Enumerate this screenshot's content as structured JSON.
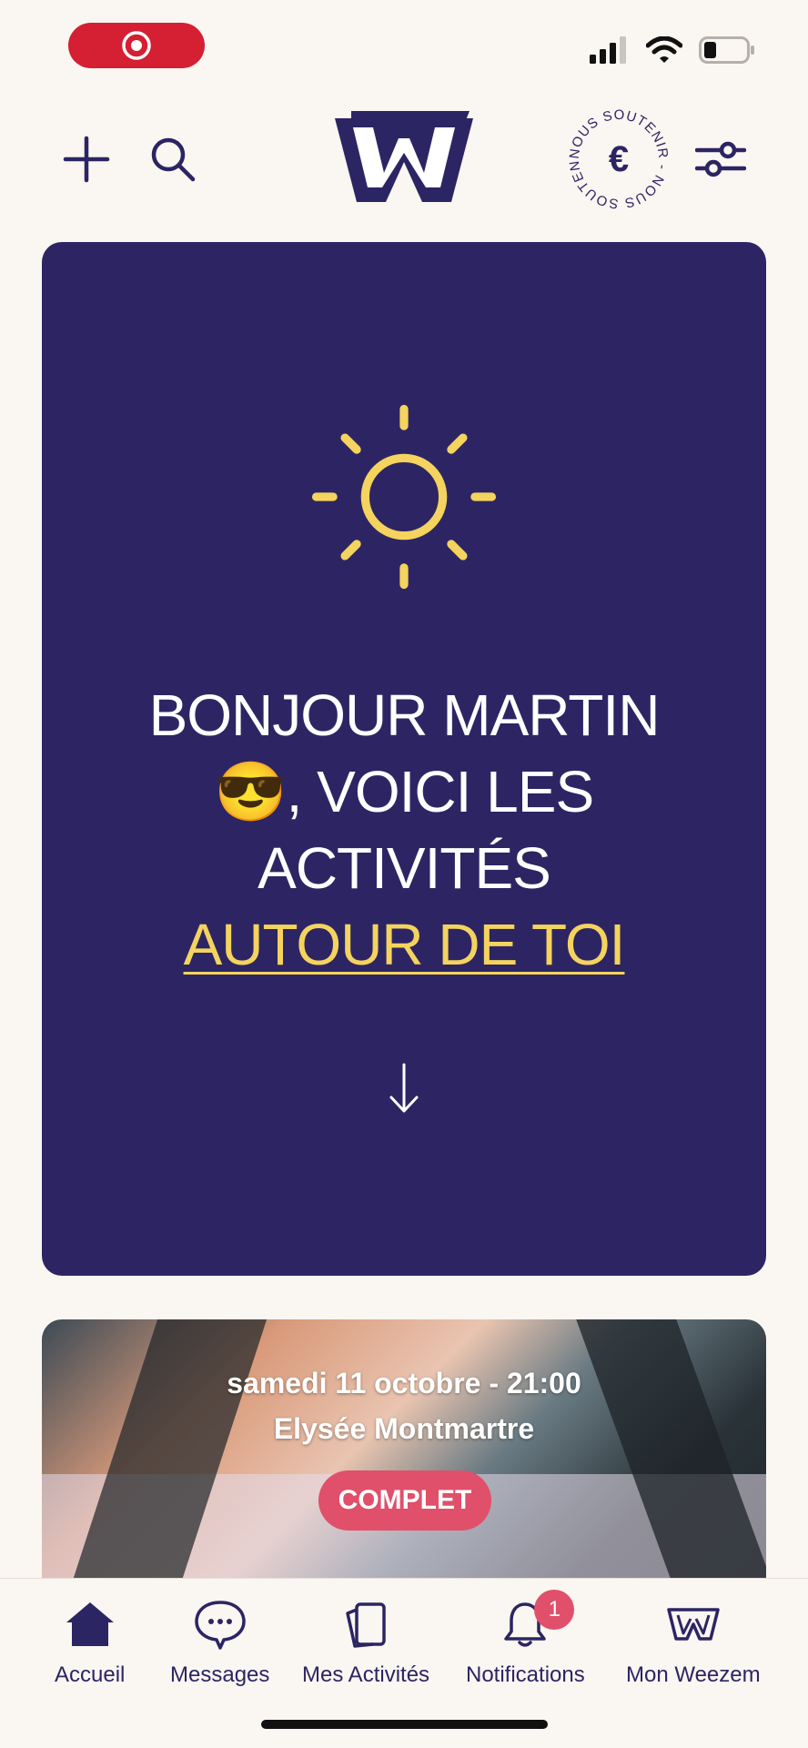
{
  "colors": {
    "primary": "#2d2563",
    "accent_yellow": "#f4d35e",
    "badge_pink": "#e0506a",
    "record_red": "#d51f33",
    "background": "#faf6f1"
  },
  "status_bar": {
    "icons": [
      "record-icon",
      "cellular-signal-icon",
      "wifi-icon",
      "battery-icon"
    ]
  },
  "header": {
    "add_icon": "plus-icon",
    "search_icon": "search-icon",
    "logo_letter": "W",
    "support_text": "NOUS SOUTENIR - NOUS SOUTENIR -",
    "support_symbol": "€",
    "filter_icon": "sliders-icon"
  },
  "hero": {
    "greeting_line1": "BONJOUR MARTIN",
    "greeting_emoji": "😎",
    "greeting_line2": ", VOICI LES",
    "greeting_line3": "ACTIVITÉS",
    "highlight": "AUTOUR DE TOI",
    "sun_icon": "sun-icon",
    "arrow_icon": "arrow-down-icon"
  },
  "event": {
    "date": "samedi 11 octobre - 21:00",
    "place": "Elysée Montmartre",
    "status": "COMPLET"
  },
  "bottom_nav": {
    "items": [
      {
        "label": "Accueil",
        "icon": "home-icon"
      },
      {
        "label": "Messages",
        "icon": "chat-icon"
      },
      {
        "label": "Mes Activités",
        "icon": "cards-icon"
      },
      {
        "label": "Notifications",
        "icon": "bell-icon",
        "badge": "1"
      },
      {
        "label": "Mon Weezem",
        "icon": "weezem-logo-icon"
      }
    ]
  }
}
